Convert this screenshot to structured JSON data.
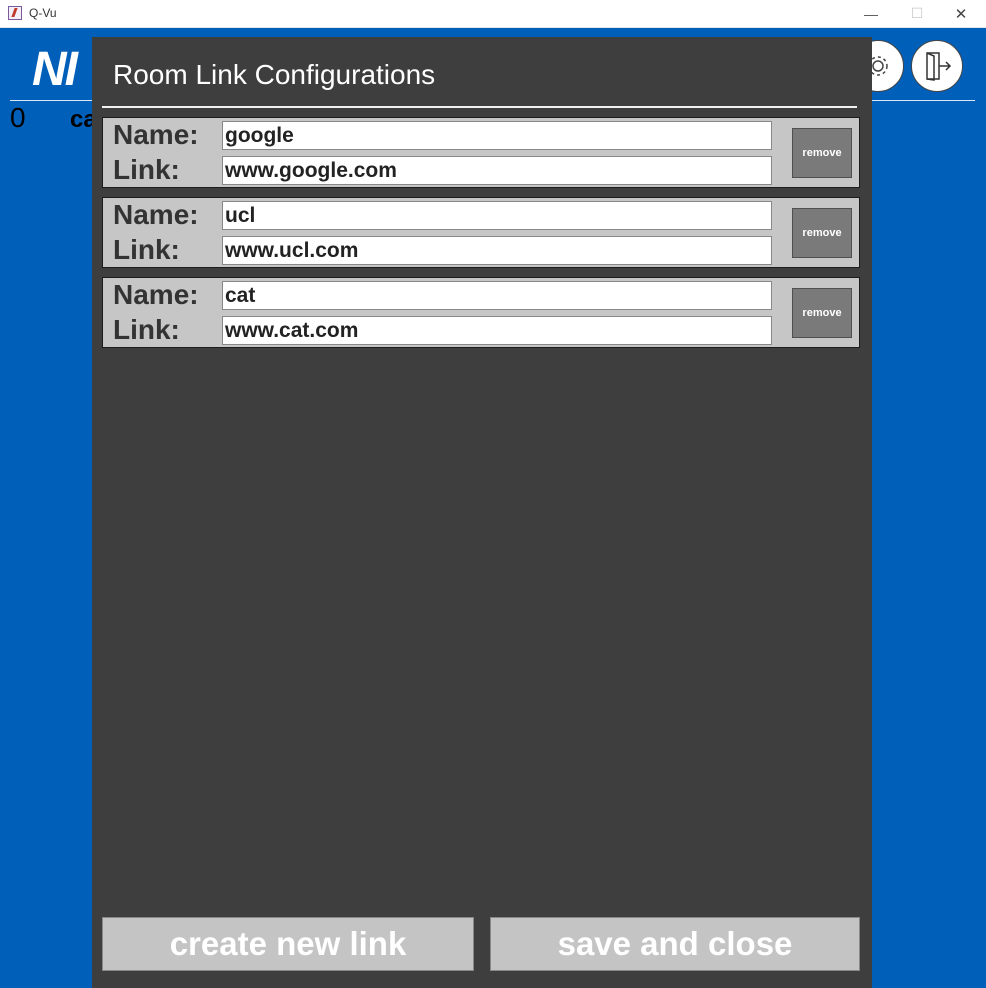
{
  "window": {
    "title": "Q-Vu",
    "minimize_icon": "minimize-icon",
    "maximize_icon": "maximize-icon",
    "close_icon": "close-icon",
    "minimize_glyph": "—",
    "maximize_glyph": "☐",
    "close_glyph": "✕"
  },
  "background": {
    "logo_text": "NI",
    "count": "0",
    "partial_name": "ca",
    "accent": "#005fb8",
    "settings_icon": "gear-icon",
    "logout_icon": "logout-icon"
  },
  "dialog": {
    "title": "Room Link Configurations",
    "name_label": "Name:",
    "link_label": "Link:",
    "remove_label": "remove",
    "links": [
      {
        "name": "google",
        "link": "www.google.com"
      },
      {
        "name": "ucl",
        "link": "www.ucl.com"
      },
      {
        "name": "cat",
        "link": "www.cat.com"
      }
    ],
    "create_label": "create new link",
    "save_label": "save and close",
    "bg_color": "#3e3e3e"
  }
}
